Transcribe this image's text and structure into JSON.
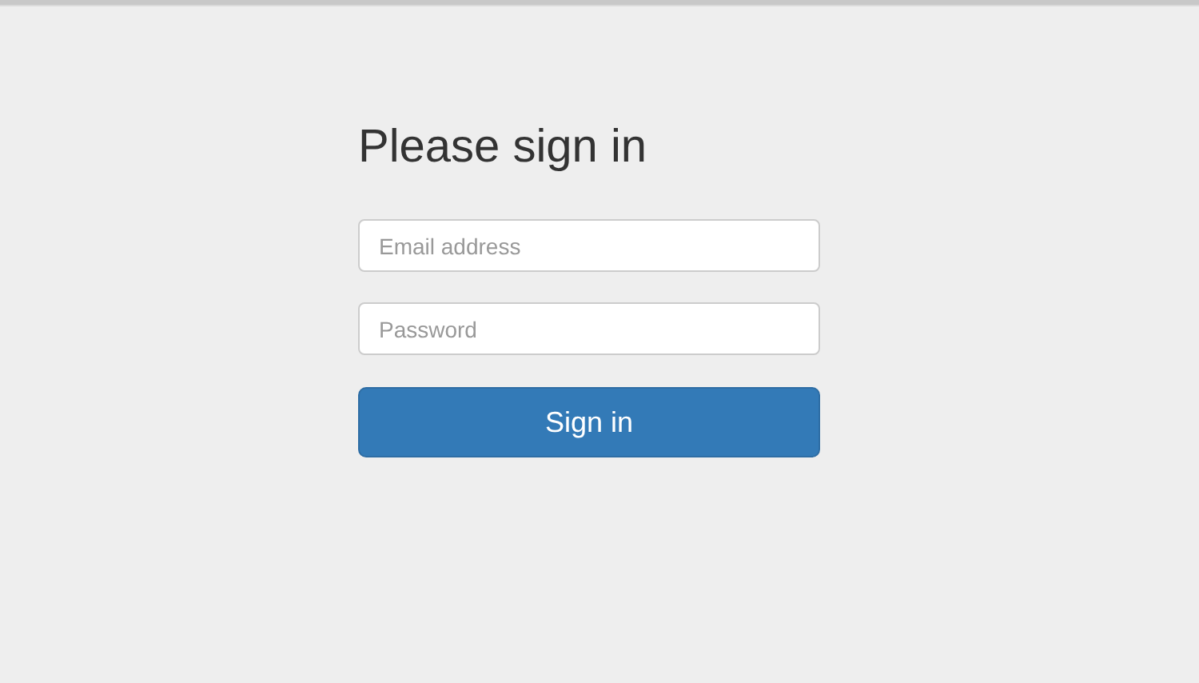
{
  "heading": "Please sign in",
  "fields": [
    {
      "placeholder": "Email address"
    },
    {
      "placeholder": "Password"
    }
  ],
  "button": "Sign in"
}
